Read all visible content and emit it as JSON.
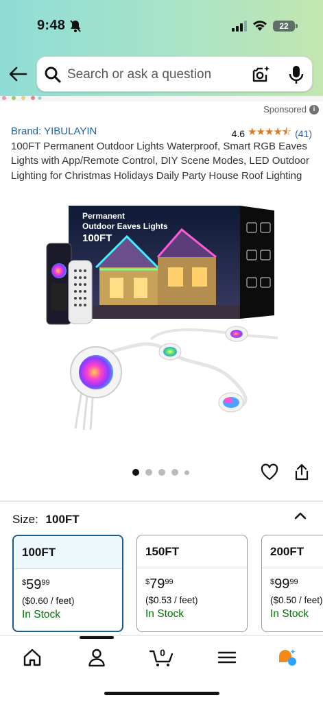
{
  "status_bar": {
    "time": "9:48",
    "battery": "22"
  },
  "search": {
    "placeholder": "Search or ask a question"
  },
  "product": {
    "sponsored_label": "Sponsored",
    "brand": "Brand: YIBULAYIN",
    "rating": "4.6",
    "stars": "★★★★⯪",
    "review_count": "(41)",
    "title": "100FT Permanent Outdoor Lights Waterproof, Smart RGB Eaves Lights with App/Remote Control, DIY Scene Modes, LED Outdoor Lighting for Christmas Holidays Daily Party House Roof Lighting",
    "image_caption_line1": "Permanent",
    "image_caption_line2": "Outdoor Eaves Lights",
    "image_caption_line3": "100FT",
    "carousel_page": 1,
    "carousel_count": 5
  },
  "size_selector": {
    "label": "Size:",
    "selected": "100FT",
    "options": [
      {
        "name": "100FT",
        "dollars": "59",
        "cents": "99",
        "unit_price": "($0.60 / feet)",
        "availability": "In Stock"
      },
      {
        "name": "150FT",
        "dollars": "79",
        "cents": "99",
        "unit_price": "($0.53 / feet)",
        "availability": "In Stock"
      },
      {
        "name": "200FT",
        "dollars": "99",
        "cents": "99",
        "unit_price": "($0.50 / feet)",
        "availability": "In Stock"
      }
    ]
  },
  "tabbar": {
    "cart_count": "0"
  },
  "colors": {
    "link": "#2162a1",
    "star": "#de7921",
    "in_stock": "#007600",
    "selected_border": "#1b5c8e"
  }
}
